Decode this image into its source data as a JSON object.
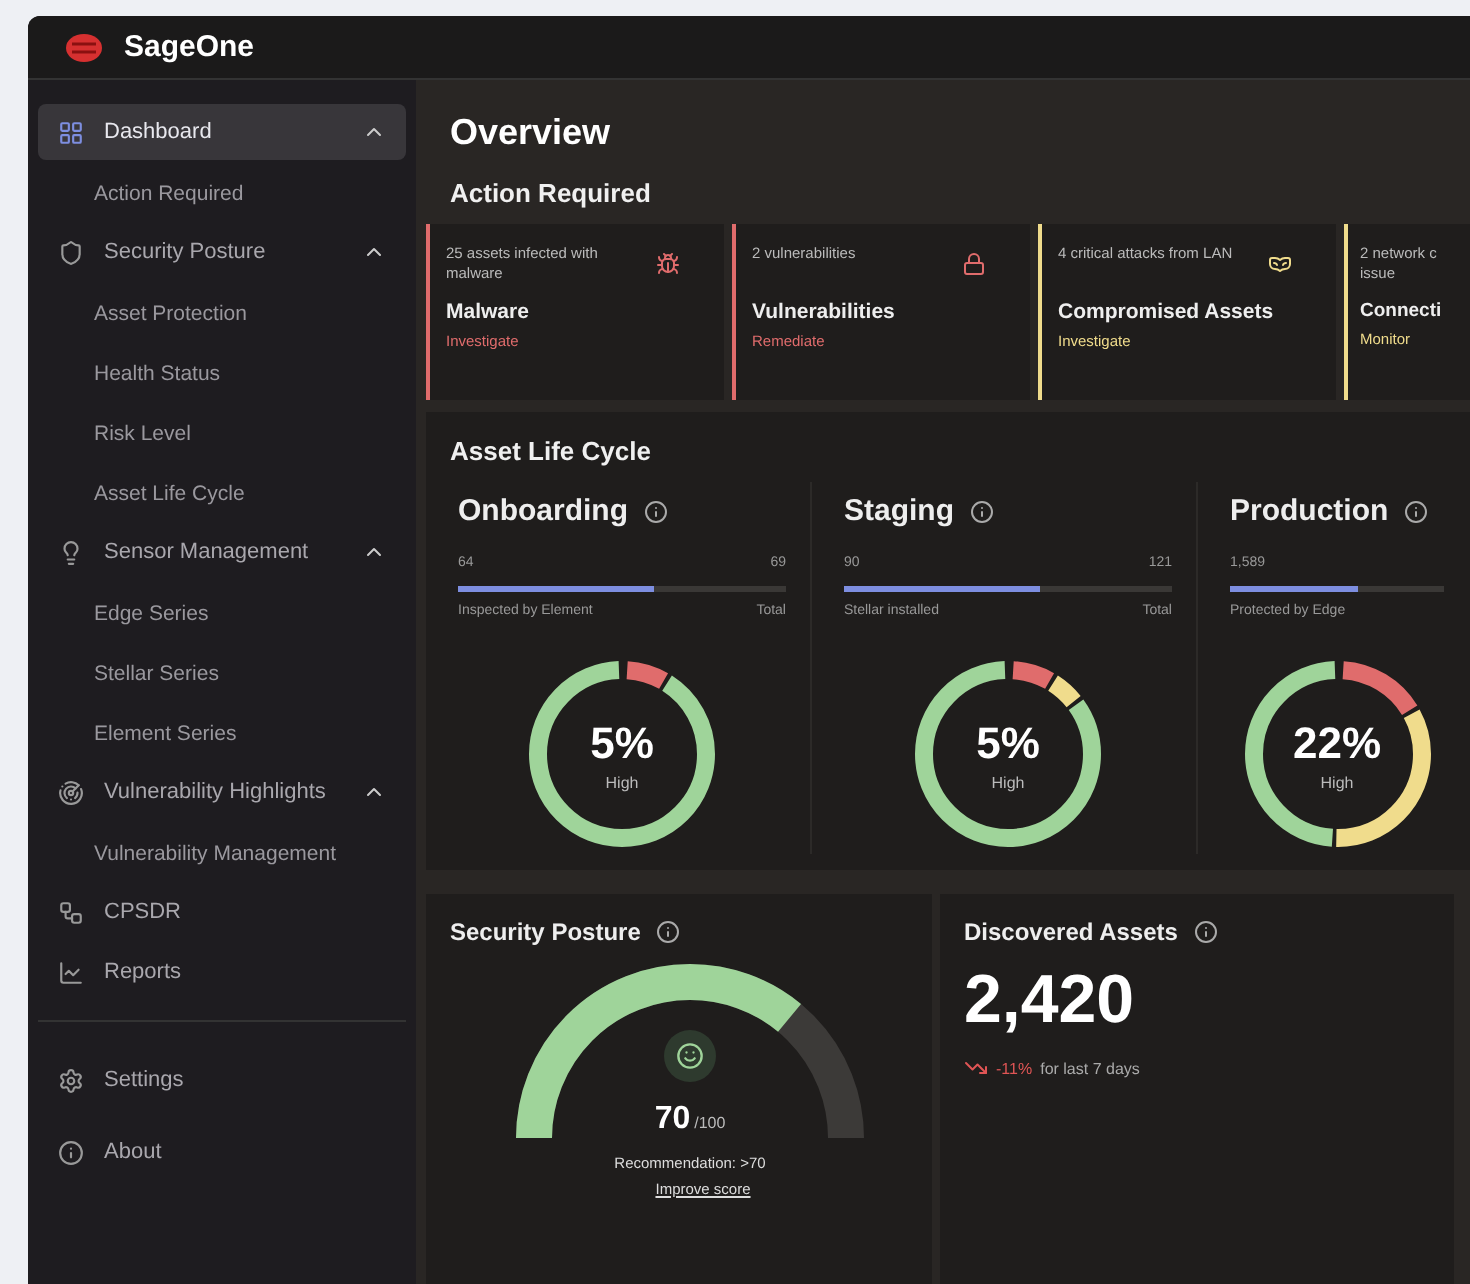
{
  "app": {
    "name": "SageOne"
  },
  "sidebar": {
    "items": [
      {
        "label": "Dashboard",
        "selected": true,
        "expanded": true,
        "children": [
          {
            "label": "Action Required",
            "selected": false
          }
        ]
      },
      {
        "label": "Security Posture",
        "selected": false,
        "expanded": true,
        "children": [
          {
            "label": "Asset Protection",
            "selected": false
          },
          {
            "label": "Health Status",
            "selected": false
          },
          {
            "label": "Risk Level",
            "selected": false
          },
          {
            "label": "Asset Life Cycle",
            "selected": false
          }
        ]
      },
      {
        "label": "Sensor Management",
        "selected": false,
        "expanded": true,
        "children": [
          {
            "label": "Edge Series",
            "selected": false
          },
          {
            "label": "Stellar Series",
            "selected": false
          },
          {
            "label": "Element Series",
            "selected": false
          }
        ]
      },
      {
        "label": "Vulnerability Highlights",
        "selected": false,
        "expanded": true,
        "children": [
          {
            "label": "Vulnerability Management",
            "selected": false
          }
        ]
      },
      {
        "label": "CPSDR",
        "selected": false
      },
      {
        "label": "Reports",
        "selected": false
      }
    ],
    "footer_items": [
      {
        "label": "Settings",
        "selected": false
      },
      {
        "label": "About",
        "selected": false
      }
    ]
  },
  "page": {
    "title": "Overview"
  },
  "action_required": {
    "title": "Action Required",
    "cards": [
      {
        "description": "25 assets infected with malware",
        "title": "Malware",
        "action": "Investigate",
        "color": "#e06c6c"
      },
      {
        "description": "2 vulnerabilities",
        "title": "Vulnerabilities",
        "action": "Remediate",
        "color": "#e06c6c"
      },
      {
        "description": "4 critical attacks from LAN",
        "title": "Compromised Assets",
        "action": "Investigate",
        "color": "#f0dc8c"
      },
      {
        "description": "2 network c issue",
        "title": "Connecti",
        "action": "Monitor",
        "color": "#f0dc8c"
      }
    ]
  },
  "asset_life_cycle": {
    "title": "Asset Life Cycle",
    "stages": [
      {
        "title": "Onboarding",
        "count": "64",
        "total": "69",
        "count_label": "Inspected by Element",
        "total_label": "Total",
        "level": 0.6,
        "percent": "5%",
        "severity": "High"
      },
      {
        "title": "Staging",
        "count": "90",
        "total": "121",
        "count_label": "Stellar installed",
        "total_label": "Total",
        "level": 0.6,
        "percent": "5%",
        "severity": "High"
      },
      {
        "title": "Production",
        "count": "1,589",
        "count_label": "Protected by Edge",
        "level": 0.6,
        "percent": "22%",
        "severity": "High"
      }
    ]
  },
  "security_posture": {
    "title": "Security Posture",
    "score": "70",
    "max": "/100",
    "recommendation": "Recommendation: >70",
    "link": "Improve score"
  },
  "discovered_assets": {
    "title": "Discovered Assets",
    "value": "2,420",
    "change": "-11%",
    "period": "for last 7 days"
  }
}
